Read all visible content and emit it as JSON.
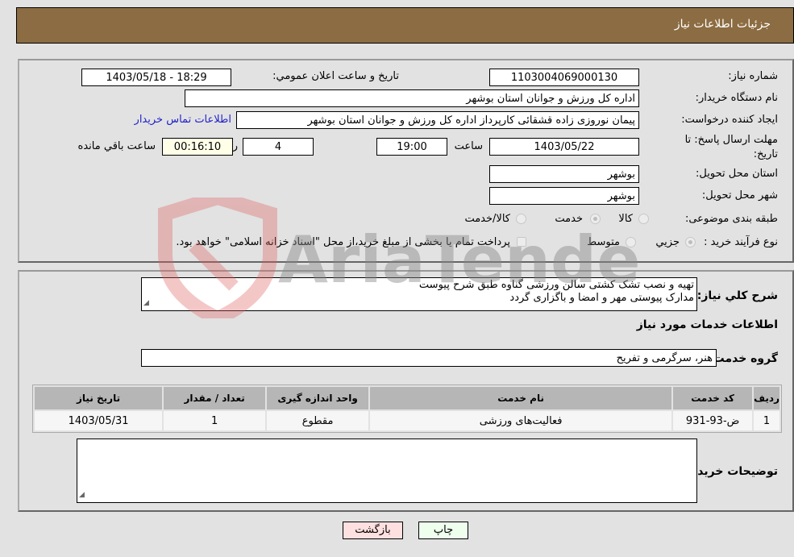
{
  "header": {
    "title": "جزئیات اطلاعات نیاز"
  },
  "details": {
    "need_number_label": "شماره نیاز:",
    "need_number": "1103004069000130",
    "announce_label": "تاریخ و ساعت اعلان عمومي:",
    "announce_value": "1403/05/18 - 18:29",
    "buyer_org_label": "نام دستگاه خريدار:",
    "buyer_org": "اداره کل ورزش و جوانان استان بوشهر",
    "creator_label": "ايجاد کننده درخواست:",
    "creator": "پیمان نوروزی زاده قشقائی کارپرداز اداره کل ورزش و جوانان استان بوشهر",
    "contact_link": "اطلاعات تماس خریدار",
    "deadline_label": "مهلت ارسال پاسخ: تا تاریخ:",
    "deadline_date": "1403/05/22",
    "time_label": "ساعت",
    "deadline_time": "19:00",
    "days_value": "4",
    "days_label": "روز و",
    "remaining_value": "00:16:10",
    "remaining_label": "ساعت باقي مانده",
    "province_label": "استان محل تحویل:",
    "province": "بوشهر",
    "city_label": "شهر محل تحویل:",
    "city": "بوشهر",
    "category_label": "طبقه بندی موضوعی:",
    "category_options": [
      {
        "label": "کالا",
        "selected": false
      },
      {
        "label": "خدمت",
        "selected": true
      },
      {
        "label": "کالا/خدمت",
        "selected": false
      }
    ],
    "process_label": "نوع فرآیند خرید :",
    "process_options": [
      {
        "label": "جزیي",
        "selected": true
      },
      {
        "label": "متوسط",
        "selected": false
      }
    ],
    "treasury_checkbox_label": "پرداخت تمام یا بخشی از مبلغ خرید،از محل \"اسناد خزانه اسلامی\" خواهد بود.",
    "treasury_checked": false
  },
  "description": {
    "label": "شرح کلي نياز:",
    "line1": "تهیه و نصب تشک کشتی سالن ورزشی گناوه طبق شرح پیوست",
    "line2": "مدارک پیوستی مهر و امضا و باگزاری گردد"
  },
  "services": {
    "section_title": "اطلاعات خدمات مورد نياز",
    "group_label": "گروه خدمت:",
    "group_value": "هنر، سرگرمی و تفریح",
    "columns": [
      "رديف",
      "کد خدمت",
      "نام خدمت",
      "واحد اندازه گيری",
      "تعداد / مقدار",
      "تاريخ نياز"
    ],
    "rows": [
      [
        "1",
        "ض-93-931",
        "فعالیت‌های ورزشی",
        "مقطوع",
        "1",
        "1403/05/31"
      ]
    ]
  },
  "buyer_notes": {
    "label": "توضيحات خريدار:",
    "value": ""
  },
  "buttons": {
    "print": "چاپ",
    "back": "بازگشت"
  },
  "watermark": {
    "text": "AriaTender.neT"
  }
}
